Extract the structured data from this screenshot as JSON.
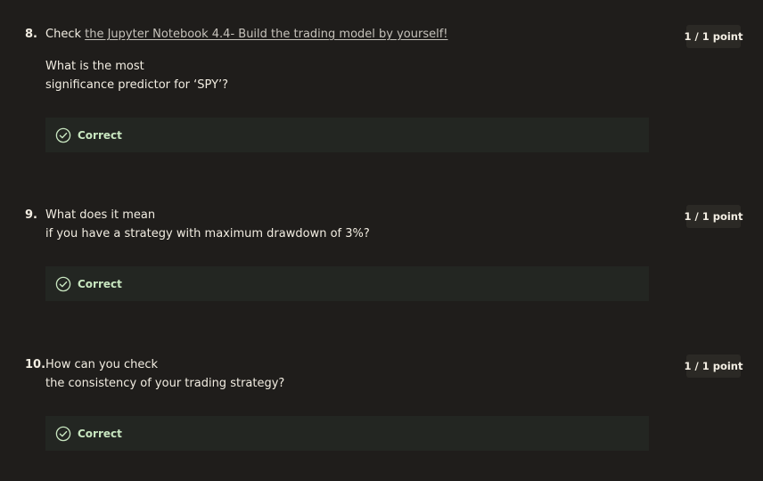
{
  "colors": {
    "background": "#1f1d1b",
    "text": "#f2ede2",
    "link": "#c6c2bb",
    "badge_bg": "#2b2925",
    "feedback_bg": "#232622",
    "correct_green": "#c8e6c0"
  },
  "questions": [
    {
      "number": "8.",
      "prefix": "Check ",
      "link_text": "the Jupyter Notebook 4.4- Build the trading model by yourself!",
      "line1": "What is the most",
      "line2": "significance predictor for ‘SPY’?",
      "points": "1 / 1 point",
      "feedback": "Correct",
      "feedback_icon": "check-circle-icon"
    },
    {
      "number": "9.",
      "line1": "What does it mean",
      "line2": "if you have a strategy with maximum drawdown of 3%?",
      "points": "1 / 1 point",
      "feedback": "Correct",
      "feedback_icon": "check-circle-icon"
    },
    {
      "number": "10.",
      "line1": "How can you check",
      "line2": "the consistency of your trading strategy?",
      "points": "1 / 1 point",
      "feedback": "Correct",
      "feedback_icon": "check-circle-icon"
    }
  ]
}
